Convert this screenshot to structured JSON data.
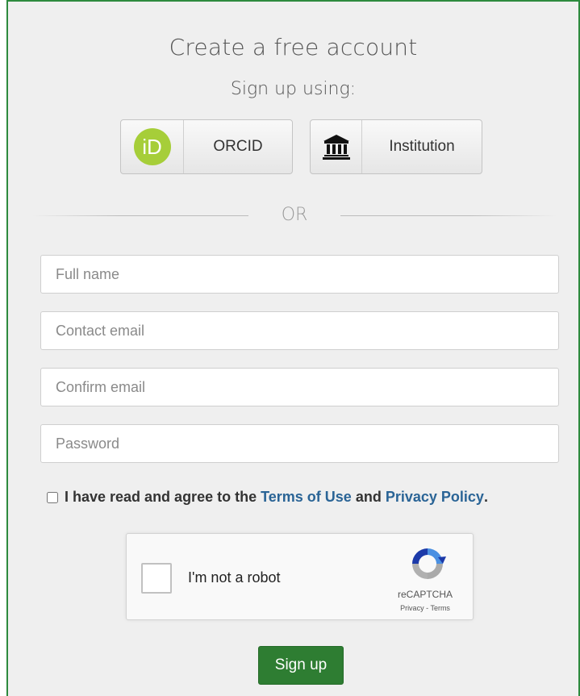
{
  "header": {
    "title": "Create a free account",
    "subtitle": "Sign up using:"
  },
  "sso": {
    "orcid": {
      "label": "ORCID",
      "icon": "orcid-icon",
      "icon_text": "iD",
      "icon_color": "#a6ce39"
    },
    "institution": {
      "label": "Institution",
      "icon": "institution-icon"
    }
  },
  "divider": {
    "label": "OR"
  },
  "form": {
    "full_name": {
      "placeholder": "Full name",
      "value": ""
    },
    "contact_email": {
      "placeholder": "Contact email",
      "value": ""
    },
    "confirm_email": {
      "placeholder": "Confirm email",
      "value": ""
    },
    "password": {
      "placeholder": "Password",
      "value": ""
    }
  },
  "agreement": {
    "prefix": "I have read and agree to the",
    "terms_link": "Terms of Use",
    "and": "and",
    "privacy_link": "Privacy Policy",
    "suffix": ".",
    "checked": false,
    "link_color": "#2a6496"
  },
  "captcha": {
    "label": "I'm not a robot",
    "brand": "reCAPTCHA",
    "privacy": "Privacy",
    "separator": "-",
    "terms": "Terms"
  },
  "submit": {
    "label": "Sign up",
    "color": "#2e7d32"
  },
  "theme": {
    "border_color": "#2d8a3e",
    "panel_bg": "#efefef"
  }
}
